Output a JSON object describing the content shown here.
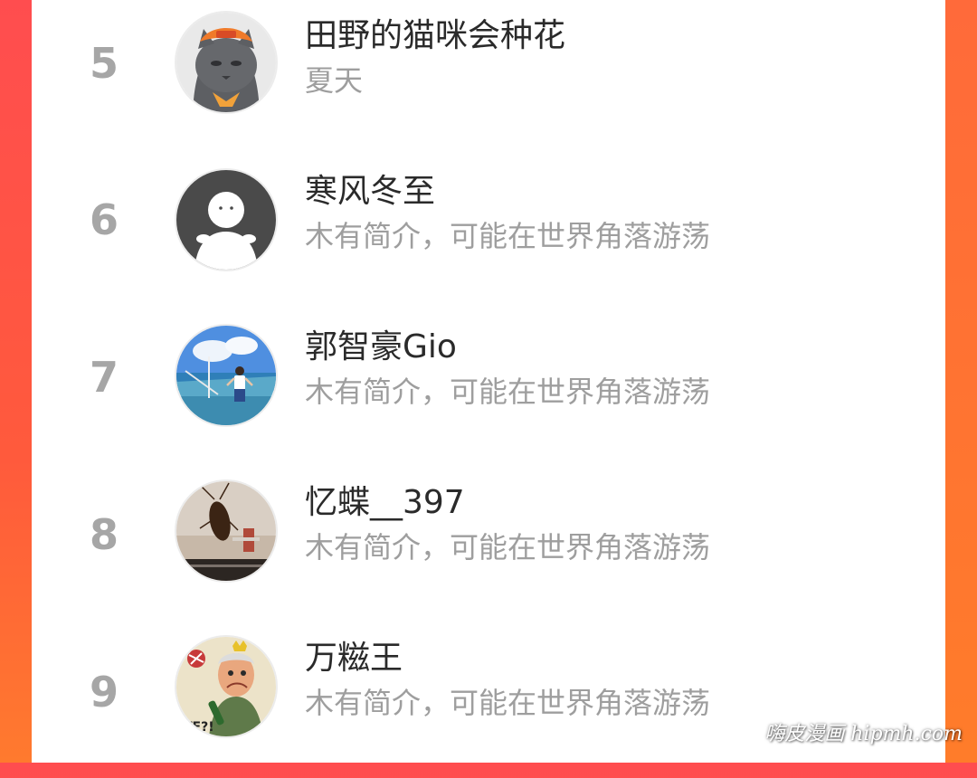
{
  "colors": {
    "rank": "#a6a6a6",
    "name": "#2a2a2a",
    "bio": "#9e9e9e",
    "background_left": "#ff4d4f",
    "background_right": "#ff7a2e"
  },
  "ranking": [
    {
      "rank": "5",
      "name": "田野的猫咪会种花",
      "bio": "夏天",
      "avatar_icon": "gray-cat-with-orange-hat"
    },
    {
      "rank": "6",
      "name": "寒风冬至",
      "bio": "木有简介，可能在世界角落游荡",
      "avatar_icon": "default-person-icon"
    },
    {
      "rank": "7",
      "name": "郭智豪Gio",
      "bio": "木有简介，可能在世界角落游荡",
      "avatar_icon": "person-on-boat-photo"
    },
    {
      "rank": "8",
      "name": "忆蝶__397",
      "bio": "木有简介，可能在世界角落游荡",
      "avatar_icon": "cockroach-on-wall-photo"
    },
    {
      "rank": "9",
      "name": "万糍王",
      "bio": "木有简介，可能在世界角落游荡",
      "avatar_icon": "cartoon-old-man-drawing"
    }
  ],
  "watermark": "嗨皮漫画 hipmh.com"
}
